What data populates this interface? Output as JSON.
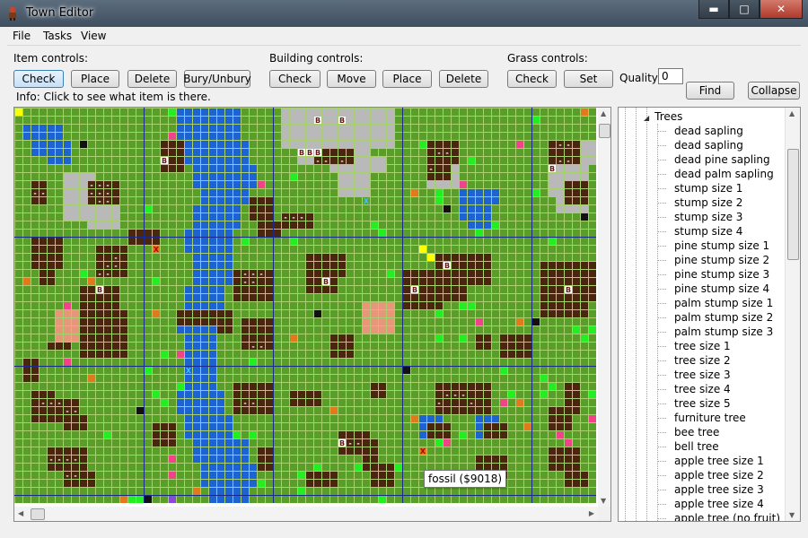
{
  "window": {
    "title": "Town Editor",
    "minimize": "▬",
    "maximize": "□",
    "close": "✕"
  },
  "menu": [
    "File",
    "Tasks",
    "View"
  ],
  "item_controls": {
    "label": "Item controls:",
    "buttons": [
      "Check",
      "Place",
      "Delete",
      "Bury/Unbury"
    ]
  },
  "building_controls": {
    "label": "Building controls:",
    "buttons": [
      "Check",
      "Move",
      "Place",
      "Delete"
    ]
  },
  "grass_controls": {
    "label": "Grass controls:",
    "buttons": [
      "Check",
      "Set"
    ],
    "quality_label": "Quality:",
    "quality_value": "0"
  },
  "find_button": "Find",
  "collapse_button": "Collapse",
  "info_text": "Info:  Click to see what item is there.",
  "tooltip": "fossil ($9018)",
  "map": {
    "colors": {
      "grass": "#5a9e2a",
      "grid": "#a8d070",
      "water": "#1e64d0",
      "stone": "#b9b9b9",
      "building": "#4a260e",
      "sand": "#e8967a",
      "orange": "#e07a1a",
      "green_item": "#22ee22",
      "pink_item": "#f0448a",
      "yellow_item": "#ffff00",
      "purple_item": "#8a4ad0",
      "black_item": "#111111",
      "acre_line": "#1a2a8a"
    },
    "cell_labels": {
      "B": "B",
      "dash": "-",
      "X": "X"
    }
  },
  "tree": {
    "root": "Trees",
    "items": [
      "dead sapling",
      "dead sapling",
      "dead pine sapling",
      "dead palm sapling",
      "stump size 1",
      "stump size 2",
      "stump size 3",
      "stump size 4",
      "pine stump size 1",
      "pine stump size 2",
      "pine stump size 3",
      "pine stump size 4",
      "palm stump size 1",
      "palm stump size 2",
      "palm stump size 3",
      "tree size 1",
      "tree size 2",
      "tree size 3",
      "tree size 4",
      "tree size 5",
      "furniture tree",
      "bee tree",
      "bell tree",
      "apple tree size 1",
      "apple tree size 2",
      "apple tree size 3",
      "apple tree size 4",
      "apple tree (no fruit)"
    ]
  }
}
